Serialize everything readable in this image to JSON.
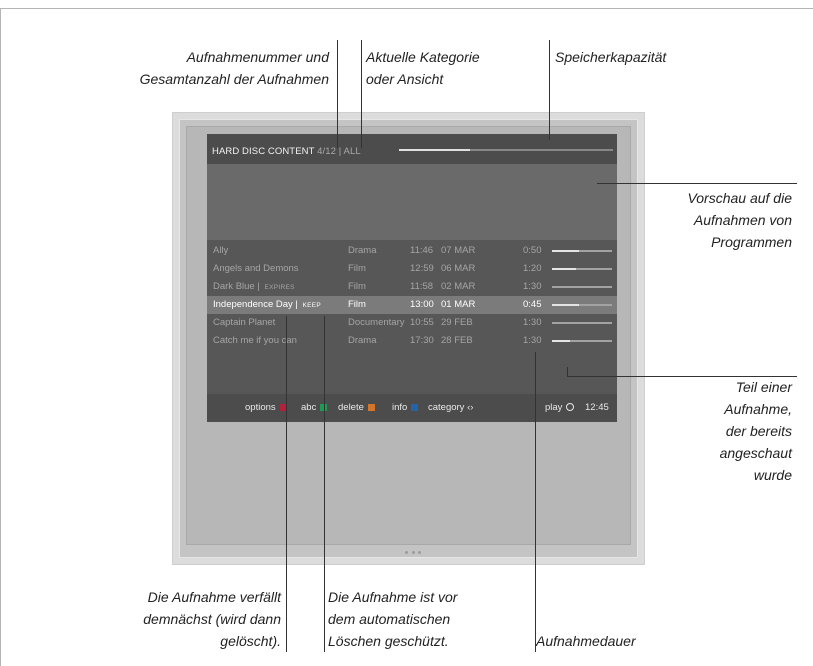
{
  "screen": {
    "header": {
      "title": "HARD DISC CONTENT",
      "counter": "4/12",
      "separator": " | ",
      "category": "ALL"
    },
    "storage_capacity_used": 0.33,
    "recordings": [
      {
        "name": "Ally",
        "tag": "",
        "category": "Drama",
        "time": "11:46",
        "date": "07 MAR",
        "duration": "0:50",
        "watched": 0.45,
        "selected": false
      },
      {
        "name": "Angels and Demons",
        "tag": "",
        "category": "Film",
        "time": "12:59",
        "date": "06 MAR",
        "duration": "1:20",
        "watched": 0.4,
        "selected": false
      },
      {
        "name": "Dark Blue",
        "tag": "EXPIRES",
        "category": "Film",
        "time": "11:58",
        "date": "02 MAR",
        "duration": "1:30",
        "watched": 0.0,
        "selected": false
      },
      {
        "name": "Independence Day",
        "tag": "KEEP",
        "category": "Film",
        "time": "13:00",
        "date": "01 MAR",
        "duration": "0:45",
        "watched": 0.45,
        "selected": true
      },
      {
        "name": "Captain Planet",
        "tag": "",
        "category": "Documentary",
        "time": "10:55",
        "date": "29 FEB",
        "duration": "1:30",
        "watched": 0.0,
        "selected": false
      },
      {
        "name": "Catch me if you can",
        "tag": "",
        "category": "Drama",
        "time": "17:30",
        "date": "28 FEB",
        "duration": "1:30",
        "watched": 0.3,
        "selected": false
      }
    ],
    "footer": {
      "options": "options",
      "abc": "abc",
      "delete": "delete",
      "info": "info",
      "category": "category",
      "category_icon": "‹›",
      "play": "play",
      "clock": "12:45"
    },
    "colors": {
      "red": "#b3203c",
      "green": "#1f9a55",
      "orange": "#d3752d",
      "blue": "#2563a8"
    }
  },
  "callouts": {
    "recording_number": [
      "Aufnahmenummer und",
      "Gesamtanzahl der Aufnahmen"
    ],
    "current_category": [
      "Aktuelle Kategorie",
      "oder Ansicht"
    ],
    "storage": [
      "Speicherkapazität"
    ],
    "preview": [
      "Vorschau auf die",
      "Aufnahmen von",
      "Programmen"
    ],
    "watched_part": [
      "Teil einer",
      "Aufnahme,",
      "der bereits",
      "angeschaut",
      "wurde"
    ],
    "expires": [
      "Die Aufnahme verfällt",
      "demnächst (wird dann",
      "gelöscht)."
    ],
    "protected": [
      "Die Aufnahme ist vor",
      "dem automatischen",
      "Löschen geschützt."
    ],
    "duration": [
      "Aufnahmedauer"
    ]
  }
}
